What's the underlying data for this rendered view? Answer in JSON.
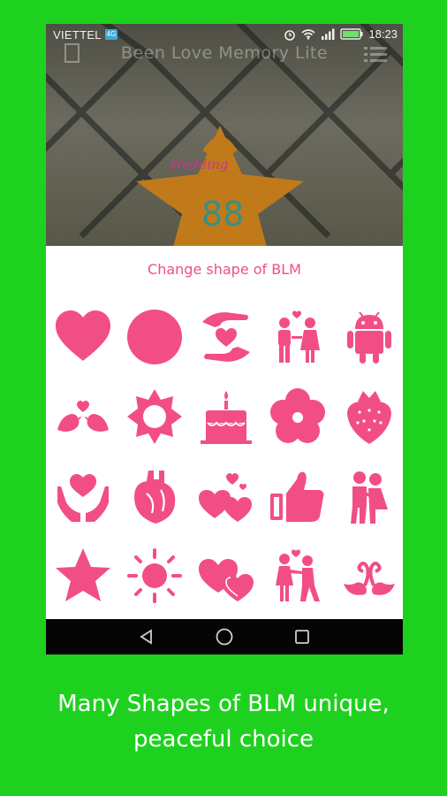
{
  "status_bar": {
    "carrier": "VIETTEL",
    "carrier_badge": "4G",
    "time": "18:23"
  },
  "app": {
    "title": "Been Love Memory Lite",
    "widget_label": "Wedding",
    "days_count": "88"
  },
  "chooser": {
    "title": "Change shape of BLM",
    "accent": "#f24e86",
    "shapes": [
      [
        "heart-icon",
        "circle-icon",
        "hands-heart-icon",
        "couple-icon",
        "android-icon"
      ],
      [
        "love-birds-icon",
        "sun-badge-icon",
        "cake-icon",
        "flower-icon",
        "strawberry-icon"
      ],
      [
        "heart-in-hands-icon",
        "anatomical-heart-icon",
        "hearts-icon",
        "thumbs-up-icon",
        "hugging-couple-icon"
      ],
      [
        "star-icon",
        "sun-icon",
        "double-heart-icon",
        "dancing-couple-icon",
        "swans-icon"
      ]
    ]
  },
  "navbar": {
    "icons": [
      "back-icon",
      "home-icon",
      "recents-icon"
    ]
  },
  "caption": {
    "line1": "Many Shapes of BLM unique,",
    "line2": "peaceful choice"
  }
}
